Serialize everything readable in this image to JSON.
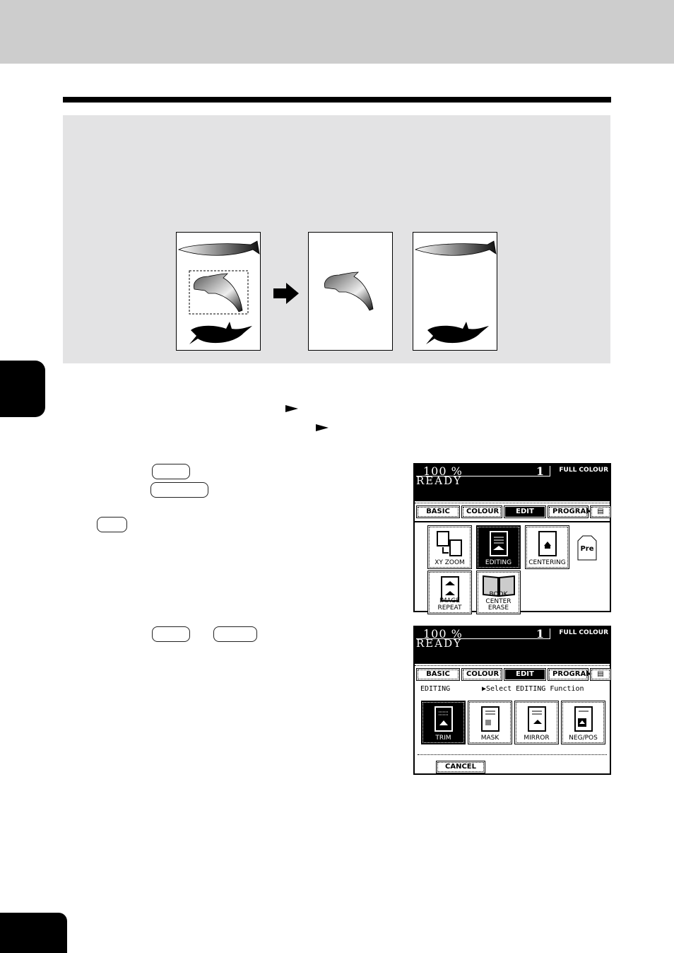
{
  "page": {
    "header_band_color": "#cdcdcd",
    "panel_color": "#e3e3e4"
  },
  "illustration": {
    "original_label": "original-with-trim-area",
    "arrow": "right-arrow",
    "result_trim_label": "trim-result",
    "result_mask_label": "mask-result"
  },
  "inline_markers": [
    "►",
    "►"
  ],
  "screen1": {
    "zoom": "100  %",
    "copies": "1",
    "color_mode": "FULL COLOUR",
    "status": "READY",
    "tabs": [
      {
        "label": "BASIC",
        "active": false
      },
      {
        "label": "COLOUR",
        "active": false
      },
      {
        "label": "EDIT",
        "active": true
      },
      {
        "label": "PROGRAM",
        "active": false
      },
      {
        "label": "",
        "active": false,
        "icon": "keypad-icon"
      }
    ],
    "functions": [
      {
        "label": "XY ZOOM",
        "selected": false
      },
      {
        "label": "EDITING",
        "selected": true
      },
      {
        "label": "CENTERING",
        "selected": false
      },
      {
        "label": "IMAGE REPEAT",
        "selected": false
      },
      {
        "label": "BOOK CENTER",
        "label2": "ERASE",
        "selected": false
      }
    ],
    "pre_button": "Pre"
  },
  "screen2": {
    "zoom": "100  %",
    "copies": "1",
    "color_mode": "FULL COLOUR",
    "status": "READY",
    "tabs": [
      {
        "label": "BASIC",
        "active": false
      },
      {
        "label": "COLOUR",
        "active": false
      },
      {
        "label": "EDIT",
        "active": true
      },
      {
        "label": "PROGRAM",
        "active": false
      },
      {
        "label": "",
        "active": false,
        "icon": "keypad-icon"
      }
    ],
    "function_name": "EDITING",
    "hint": "▶Select EDITING Function",
    "functions": [
      {
        "label": "TRIM",
        "selected": true
      },
      {
        "label": "MASK",
        "selected": false
      },
      {
        "label": "MIRROR",
        "selected": false
      },
      {
        "label": "NEG/POS",
        "selected": false
      }
    ],
    "cancel": "CANCEL"
  }
}
